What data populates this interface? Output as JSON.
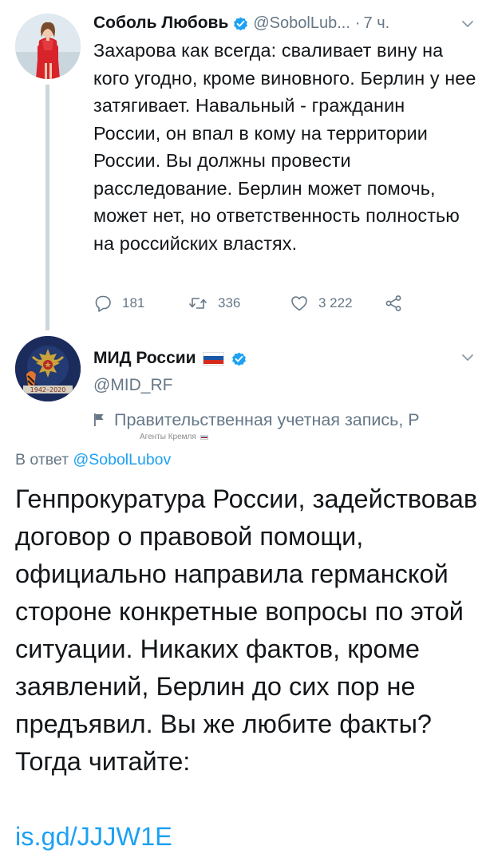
{
  "tweet1": {
    "author_name": "Соболь Любовь",
    "handle": "@SobolLub...",
    "separator": "·",
    "time": "7 ч.",
    "text": "Захарова как всегда: сваливает вину на кого угодно, кроме виновного. Берлин у нее затягивает. Навальный - гражданин России, он впал в кому на территории России. Вы должны провести расследование. Берлин может помочь, может нет, но ответственность полностью на российских властях.",
    "replies": "181",
    "retweets": "336",
    "likes": "3 222",
    "icons": {
      "reply": "reply-icon",
      "retweet": "retweet-icon",
      "like": "heart-icon",
      "share": "share-icon",
      "verified": "verified-badge-icon",
      "menu": "chevron-down-icon"
    }
  },
  "tweet2": {
    "author_name": "МИД России",
    "handle": "@MID_RF",
    "gov_label": "Правительственная учетная запись, Р",
    "agents_label": "Агенты Кремля",
    "reply_prefix": "В ответ",
    "reply_handle": "@SobolLubov",
    "text": "Генпрокуратура России, задействовав договор о правовой помощи, официально направила германской стороне конкретные вопросы по этой ситуации. Никаких фактов, кроме заявлений, Берлин до сих пор не предъявил. Вы же любите факты? Тогда читайте:",
    "link": "is.gd/JJJW1E",
    "avatar_badge_text": "1942–2020"
  },
  "colors": {
    "text": "#14171a",
    "secondary": "#657786",
    "accent": "#1da1f2",
    "thread_line": "#ccd6dd",
    "flag_white": "#ffffff",
    "flag_blue": "#1c57a5",
    "flag_red": "#d52b1e"
  }
}
